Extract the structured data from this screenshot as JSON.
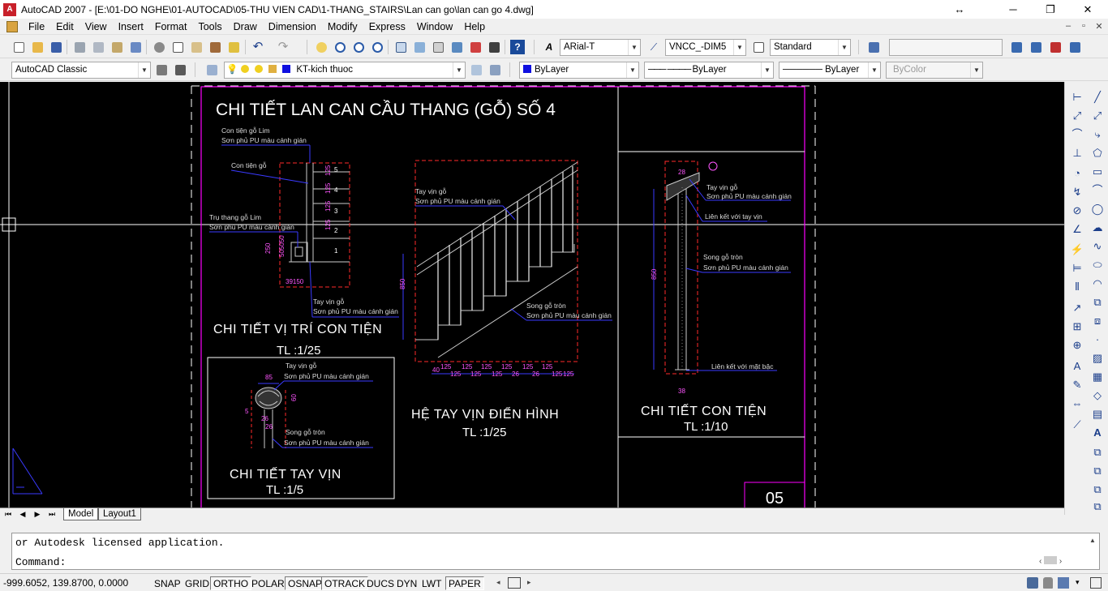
{
  "window": {
    "title": "AutoCAD 2007 - [E:\\01-DO NGHE\\01-AUTOCAD\\05-THU VIEN CAD\\1-THANG_STAIRS\\Lan can go\\lan can go 4.dwg]",
    "controls": {
      "resize": "↔",
      "minimize": "─",
      "restore": "❐",
      "close": "✕"
    },
    "doc_controls": {
      "minimize": "–",
      "restore": "▫",
      "close": "✕"
    }
  },
  "menu": [
    "File",
    "Edit",
    "View",
    "Insert",
    "Format",
    "Tools",
    "Draw",
    "Dimension",
    "Modify",
    "Express",
    "Window",
    "Help"
  ],
  "toolbar1": {
    "text_style": "ARial-T",
    "dim_style": "VNCC_-DIM5",
    "table_style": "Standard",
    "icons": [
      "new-icon",
      "open-icon",
      "save-icon",
      "plot-icon",
      "plot-preview-icon",
      "publish-icon",
      "3d-dwf-icon",
      "cut-icon",
      "copy-icon",
      "paste-icon",
      "match-properties-icon",
      "block-editor-icon",
      "undo-icon",
      "redo-icon",
      "pan-icon",
      "zoom-realtime-icon",
      "zoom-window-icon",
      "zoom-previous-icon",
      "properties-icon",
      "design-center-icon",
      "tool-palettes-icon",
      "sheet-set-icon",
      "markup-icon",
      "quickcalc-icon",
      "help-icon"
    ]
  },
  "toolbar2": {
    "workspace": "AutoCAD Classic",
    "layer": "KT-kich thuoc",
    "color": "ByLayer",
    "linetype": "ByLayer",
    "lineweight": "ByLayer",
    "plotstyle": "ByColor"
  },
  "colors": {
    "canvas_bg": "#000000",
    "magenta": "#ff00ff",
    "red_dash": "#ff2a2a",
    "blue_leader": "#3a3aff",
    "cyan": "#00c8ff",
    "white": "#ffffff"
  },
  "drawing": {
    "main_title": "CHI TIẾT LAN CAN CẦU THANG (GỖ) SỐ 4",
    "sheet_number": "05",
    "views": [
      {
        "title": "CHI TIẾT VỊ TRÍ CON TIỆN",
        "scale": "TL :1/25"
      },
      {
        "title": "HỆ TAY VỊN ĐIỂN HÌNH",
        "scale": "TL :1/25"
      },
      {
        "title": "CHI TIẾT CON TIỆN",
        "scale": "TL :1/10"
      },
      {
        "title": "CHI TIẾT TAY VỊN",
        "scale": "TL :1/5"
      }
    ],
    "notes": {
      "con_tien_lim": "Con tiện gỗ Lim",
      "son_phu": "Sơn phủ PU màu cánh gián",
      "con_tien_go": "Con tiện gỗ",
      "tru_thang": "Trụ thang gỗ Lim",
      "tay_vin": "Tay vịn gỗ",
      "song_go_tron": "Song gỗ tròn",
      "lien_ket_tay_vin": "Liên kết với tay vịn",
      "lien_ket_mat_bac": "Liên kết với mặt bậc"
    },
    "dims": {
      "d125": "125",
      "d250": "250",
      "d505050": "505050",
      "d3950": "39150",
      "d850": "850",
      "d850b": "850",
      "d40": "40",
      "d26": "26",
      "d85": "85",
      "d60": "60",
      "d5": "5",
      "d38": "38",
      "d28": "28",
      "steps": [
        "1",
        "2",
        "3",
        "4",
        "5"
      ]
    }
  },
  "layout_tabs": [
    "Model",
    "Layout1"
  ],
  "command": {
    "history": "or Autodesk licensed application.",
    "prompt": "Command:"
  },
  "status": {
    "coords": "-999.6052, 139.8700, 0.0000",
    "buttons": [
      "SNAP",
      "GRID",
      "ORTHO",
      "POLAR",
      "OSNAP",
      "OTRACK",
      "DUCS",
      "DYN",
      "LWT",
      "PAPER"
    ]
  }
}
